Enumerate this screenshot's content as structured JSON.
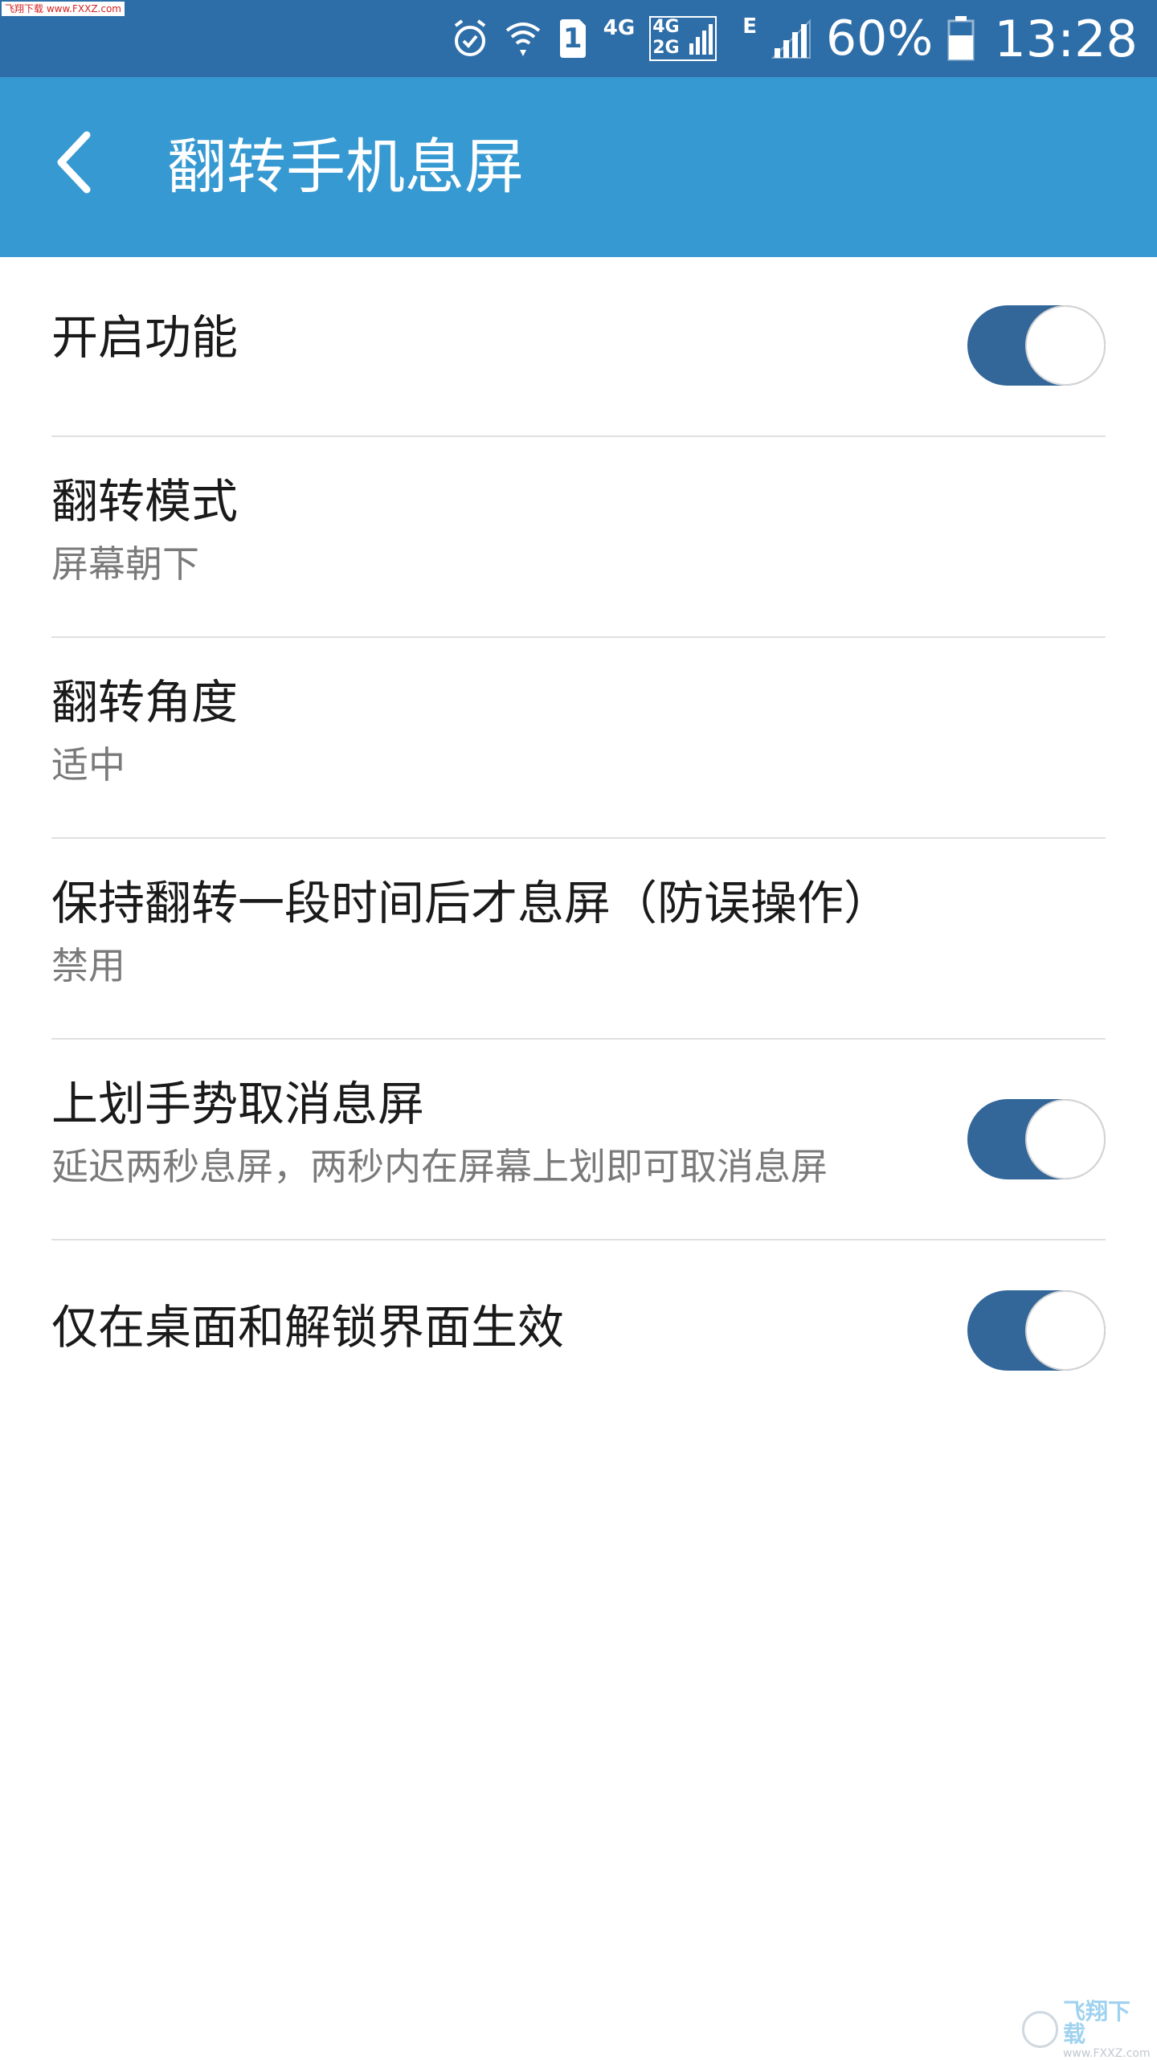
{
  "watermark": {
    "top_text": "飞翔下载 www.FXXZ.com",
    "bottom_main": "飞翔下载",
    "bottom_sub": "www.FXXZ.com"
  },
  "status_bar": {
    "network_label": "4G",
    "sim_network_top": "4G",
    "sim_network_bottom": "2G",
    "sim_slot": "1",
    "edge_label": "E",
    "battery_percent": "60%",
    "time": "13:28",
    "icons": [
      "alarm-icon",
      "wifi-icon",
      "sim-1-icon",
      "signal-icon",
      "signal-icon",
      "battery-icon"
    ]
  },
  "toolbar": {
    "title": "翻转手机息屏",
    "back_icon": "chevron-left-icon"
  },
  "settings": {
    "items": [
      {
        "title": "开启功能",
        "subtitle": "",
        "toggle": true
      },
      {
        "title": "翻转模式",
        "subtitle": "屏幕朝下"
      },
      {
        "title": "翻转角度",
        "subtitle": "适中"
      },
      {
        "title": "保持翻转一段时间后才息屏（防误操作）",
        "subtitle": "禁用"
      },
      {
        "title": "上划手势取消息屏",
        "subtitle": "延迟两秒息屏，两秒内在屏幕上划即可取消息屏",
        "toggle": true
      },
      {
        "title": "仅在桌面和解锁界面生效",
        "subtitle": "",
        "toggle": true
      }
    ]
  },
  "colors": {
    "status_bar": "#2e6ea8",
    "toolbar": "#3699d2",
    "toggle_on": "#336699",
    "divider": "#e0e0e0"
  }
}
